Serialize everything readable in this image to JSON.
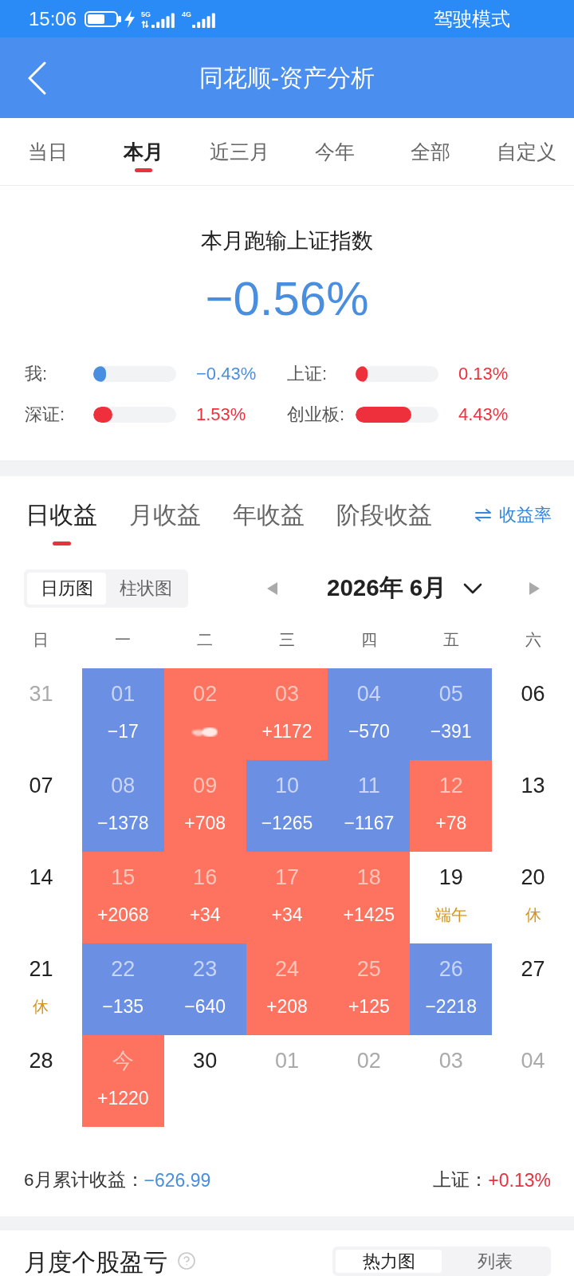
{
  "status_bar": {
    "time": "15:06",
    "networks": [
      "5G",
      "4G"
    ],
    "mode": "驾驶模式"
  },
  "header": {
    "title": "同花顺-资产分析"
  },
  "period_tabs": [
    {
      "label": "当日",
      "selected": false
    },
    {
      "label": "本月",
      "selected": true
    },
    {
      "label": "近三月",
      "selected": false
    },
    {
      "label": "今年",
      "selected": false
    },
    {
      "label": "全部",
      "selected": false
    },
    {
      "label": "自定义",
      "selected": false
    }
  ],
  "comparison": {
    "title": "本月跑输上证指数",
    "value": "−0.56%",
    "items": [
      {
        "label": "我:",
        "level": 0.15,
        "reading": "−0.43%",
        "color": "#4a8ee0"
      },
      {
        "label": "上证:",
        "level": 0.14,
        "reading": "0.13%",
        "color": "#ee303d"
      },
      {
        "label": "深证:",
        "level": 0.23,
        "reading": "1.53%",
        "color": "#ee303d"
      },
      {
        "label": "创业板:",
        "level": 0.67,
        "reading": "4.43%",
        "color": "#ee303d"
      }
    ]
  },
  "returns": {
    "tabs": [
      {
        "label": "日收益",
        "selected": true
      },
      {
        "label": "月收益",
        "selected": false
      },
      {
        "label": "年收益",
        "selected": false
      },
      {
        "label": "阶段收益",
        "selected": false
      }
    ],
    "rate_link": "收益率",
    "views": [
      {
        "label": "日历图",
        "selected": true
      },
      {
        "label": "柱状图",
        "selected": false
      }
    ],
    "month": "2026年 6月",
    "weekdays": [
      "日",
      "一",
      "二",
      "三",
      "四",
      "五",
      "六"
    ],
    "weeks": [
      [
        {
          "day": "31",
          "kind": "other_month",
          "masked": false
        },
        {
          "day": "01",
          "kind": "loss",
          "value": "−17",
          "masked": false
        },
        {
          "day": "02",
          "kind": "gain",
          "masked": true
        },
        {
          "day": "03",
          "kind": "gain",
          "value": "+1172",
          "masked": false
        },
        {
          "day": "04",
          "kind": "loss",
          "value": "−570",
          "masked": false
        },
        {
          "day": "05",
          "kind": "loss",
          "value": "−391",
          "masked": false
        },
        {
          "day": "06",
          "kind": "plain",
          "masked": false
        }
      ],
      [
        {
          "day": "07",
          "kind": "plain",
          "masked": false
        },
        {
          "day": "08",
          "kind": "loss",
          "value": "−1378",
          "masked": false
        },
        {
          "day": "09",
          "kind": "gain",
          "value": "+708",
          "masked": false
        },
        {
          "day": "10",
          "kind": "loss",
          "value": "−1265",
          "masked": false
        },
        {
          "day": "11",
          "kind": "loss",
          "value": "−1167",
          "masked": false
        },
        {
          "day": "12",
          "kind": "gain",
          "value": "+78",
          "masked": false
        },
        {
          "day": "13",
          "kind": "plain",
          "masked": false
        }
      ],
      [
        {
          "day": "14",
          "kind": "plain",
          "masked": false
        },
        {
          "day": "15",
          "kind": "gain",
          "value": "+2068",
          "masked": false
        },
        {
          "day": "16",
          "kind": "gain",
          "value": "+34",
          "masked": false
        },
        {
          "day": "17",
          "kind": "gain",
          "value": "+34",
          "masked": false
        },
        {
          "day": "18",
          "kind": "gain",
          "value": "+1425",
          "masked": false
        },
        {
          "day": "19",
          "kind": "plain",
          "note": "端午",
          "masked": false
        },
        {
          "day": "20",
          "kind": "plain",
          "note": "休",
          "masked": false
        }
      ],
      [
        {
          "day": "21",
          "kind": "plain",
          "note": "休",
          "masked": false
        },
        {
          "day": "22",
          "kind": "loss",
          "value": "−135",
          "masked": false
        },
        {
          "day": "23",
          "kind": "loss",
          "value": "−640",
          "masked": false
        },
        {
          "day": "24",
          "kind": "gain",
          "value": "+208",
          "masked": false
        },
        {
          "day": "25",
          "kind": "gain",
          "value": "+125",
          "masked": false
        },
        {
          "day": "26",
          "kind": "loss",
          "value": "−2218",
          "masked": false
        },
        {
          "day": "27",
          "kind": "plain",
          "masked": false
        }
      ],
      [
        {
          "day": "28",
          "kind": "plain",
          "masked": false
        },
        {
          "day": "今",
          "kind": "gain",
          "value": "+1220",
          "masked": false
        },
        {
          "day": "30",
          "kind": "plain",
          "masked": false
        },
        {
          "day": "01",
          "kind": "other_month",
          "masked": false
        },
        {
          "day": "02",
          "kind": "other_month",
          "masked": false
        },
        {
          "day": "03",
          "kind": "other_month",
          "masked": false
        },
        {
          "day": "04",
          "kind": "other_month",
          "masked": false
        }
      ]
    ],
    "totals": [
      {
        "label": "6月累计收益：",
        "value": "−626.99",
        "color": "#4a8ee0"
      },
      {
        "label": "上证：",
        "value": "+0.13%",
        "color": "#e5323e"
      }
    ]
  },
  "stock_pnl": {
    "title": "月度个股盈亏",
    "views": [
      {
        "label": "热力图",
        "selected": true
      },
      {
        "label": "列表",
        "selected": false
      }
    ]
  }
}
